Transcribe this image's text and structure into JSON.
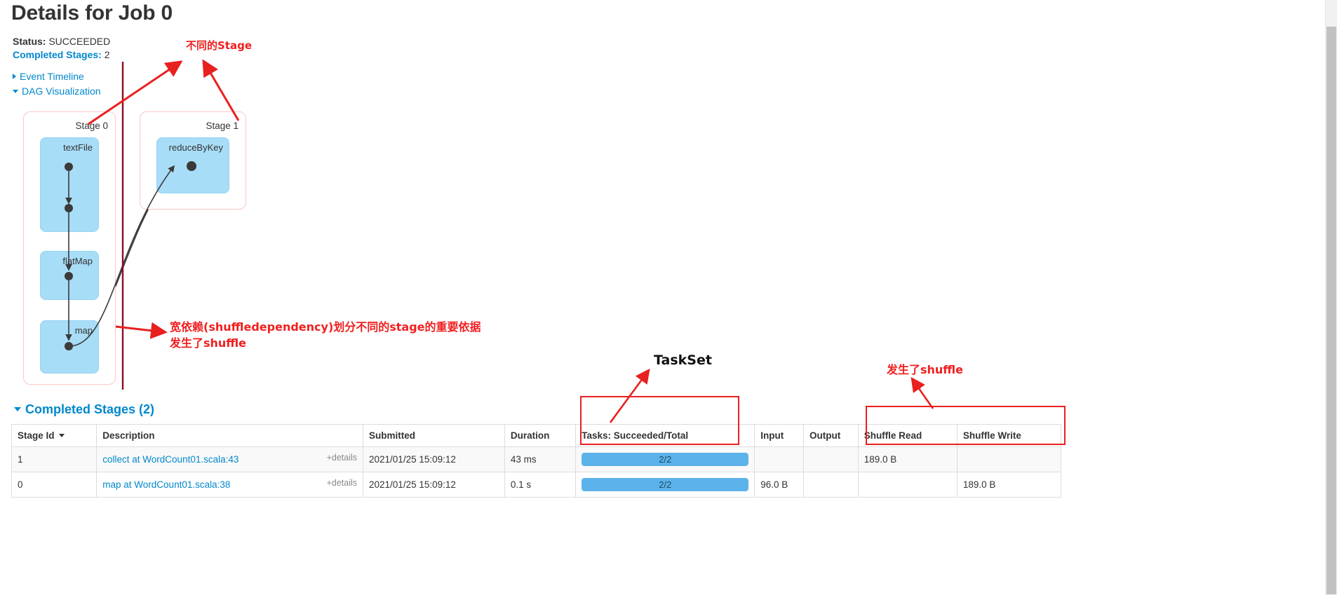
{
  "header": {
    "title": "Details for Job 0",
    "status_label": "Status:",
    "status_value": "SUCCEEDED",
    "completed_stages_label": "Completed Stages:",
    "completed_stages_value": "2",
    "event_timeline": "Event Timeline",
    "dag_visualization": "DAG Visualization"
  },
  "dag": {
    "stages": [
      {
        "label": "Stage 0",
        "rdds": [
          "textFile",
          "flatMap",
          "map"
        ]
      },
      {
        "label": "Stage 1",
        "rdds": [
          "reduceByKey"
        ]
      }
    ],
    "rdd_textfile": "textFile",
    "rdd_flatmap": "flatMap",
    "rdd_map": "map",
    "rdd_reducebykey": "reduceByKey",
    "stage0_label": "Stage 0",
    "stage1_label": "Stage 1"
  },
  "completed_stages": {
    "section_title": "Completed Stages (2)",
    "columns": [
      "Stage Id",
      "Description",
      "Submitted",
      "Duration",
      "Tasks: Succeeded/Total",
      "Input",
      "Output",
      "Shuffle Read",
      "Shuffle Write"
    ],
    "details_label": "+details",
    "rows": [
      {
        "stage_id": "1",
        "description": "collect at WordCount01.scala:43",
        "details": "+details",
        "submitted": "2021/01/25 15:09:12",
        "duration": "43 ms",
        "tasks": "2/2",
        "tasks_percent": 100,
        "input": "",
        "output": "",
        "shuffle_read": "189.0 B",
        "shuffle_write": ""
      },
      {
        "stage_id": "0",
        "description": "map at WordCount01.scala:38",
        "details": "+details",
        "submitted": "2021/01/25 15:09:12",
        "duration": "0.1 s",
        "tasks": "2/2",
        "tasks_percent": 100,
        "input": "96.0 B",
        "output": "",
        "shuffle_read": "",
        "shuffle_write": "189.0 B"
      }
    ]
  },
  "annotations": {
    "different_stage": "不同的Stage",
    "wide_dependency": "宽依赖(shuffledependency)划分不同的stage的重要依据\n发生了shuffle",
    "taskset": "TaskSet",
    "shuffle_happened": "发生了shuffle"
  },
  "colors": {
    "link": "#0088cc",
    "annotation_red": "#f01f1f",
    "annotation_box": "#e8201f",
    "rdd_fill": "#a8ddf7",
    "stage_border": "#fcc7c7",
    "progress_fill": "#5cb2ea",
    "divider_dark_red": "#8b0f1e"
  }
}
